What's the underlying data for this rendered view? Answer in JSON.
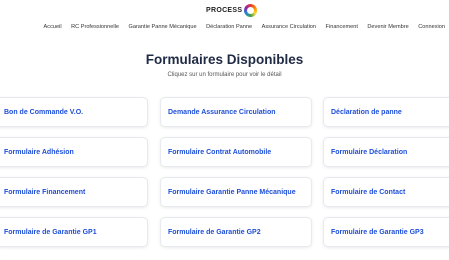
{
  "header": {
    "logo_text": "PROCESS"
  },
  "nav": {
    "items": [
      "Accueil",
      "RC Professionnelle",
      "Garantie Panne Mécanique",
      "Déclaration Panne",
      "Assurance Circulation",
      "Financement",
      "Devenir Membre",
      "Connexion"
    ]
  },
  "main": {
    "title": "Formulaires Disponibles",
    "subtitle": "Cliquez sur un formulaire pour voir le détail",
    "forms": [
      "Bon de Commande V.O.",
      "Demande Assurance Circulation",
      "Déclaration de panne",
      "Formulaire Adhésion",
      "Formulaire Contrat Automobile",
      "Formulaire Déclaration",
      "Formulaire Financement",
      "Formulaire Garantie Panne Mécanique",
      "Formulaire de Contact",
      "Formulaire de Garantie GP1",
      "Formulaire de Garantie GP2",
      "Formulaire de Garantie GP3"
    ]
  },
  "colors": {
    "accent": "#1d4ed8",
    "title": "#1f2a44"
  },
  "icons": {
    "logo": "rainbow-ring-logo-icon"
  }
}
